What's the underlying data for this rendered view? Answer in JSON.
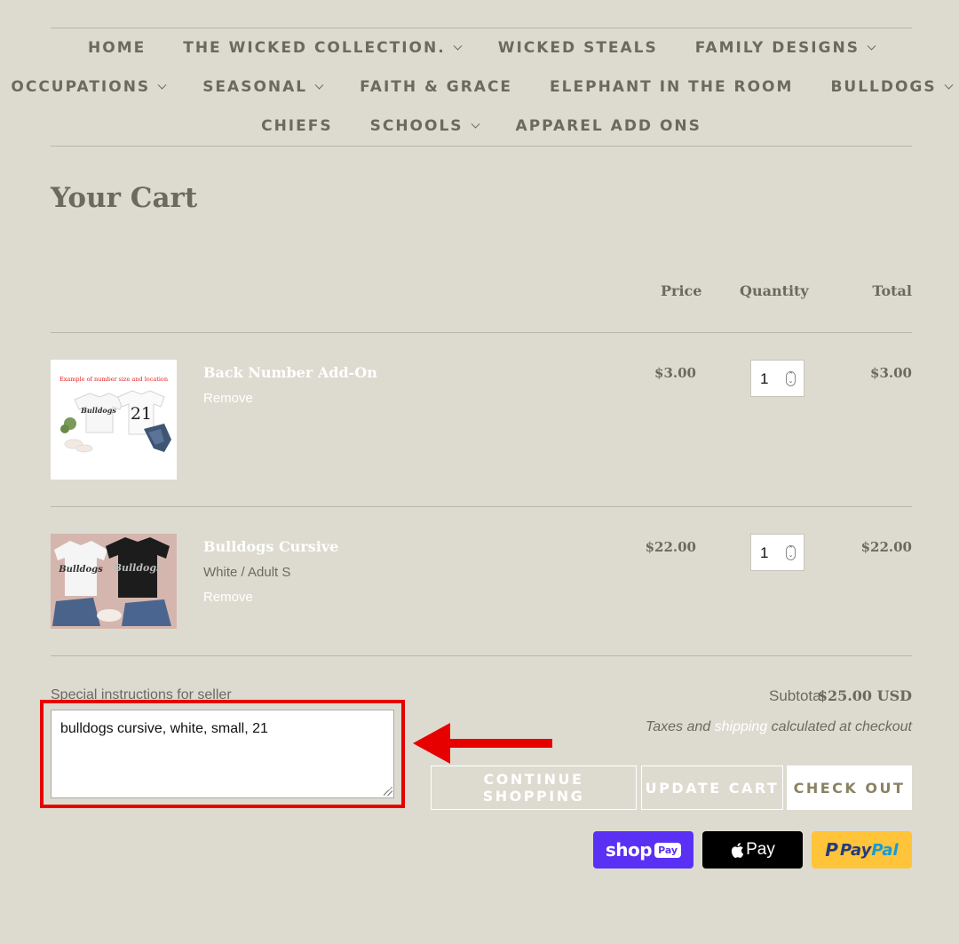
{
  "nav": {
    "row1": [
      {
        "label": "HOME",
        "dropdown": false
      },
      {
        "label": "THE WICKED COLLECTION.",
        "dropdown": true
      },
      {
        "label": "WICKED STEALS",
        "dropdown": false
      },
      {
        "label": "FAMILY DESIGNS",
        "dropdown": true
      }
    ],
    "row2": [
      {
        "label": "OCCUPATIONS",
        "dropdown": true
      },
      {
        "label": "SEASONAL",
        "dropdown": true
      },
      {
        "label": "FAITH & GRACE",
        "dropdown": false
      },
      {
        "label": "ELEPHANT IN THE ROOM",
        "dropdown": false
      },
      {
        "label": "BULLDOGS",
        "dropdown": true
      }
    ],
    "row3": [
      {
        "label": "CHIEFS",
        "dropdown": false
      },
      {
        "label": "SCHOOLS",
        "dropdown": true
      },
      {
        "label": "APPAREL ADD ONS",
        "dropdown": false
      }
    ]
  },
  "page_title": "Your Cart",
  "table_headers": {
    "price": "Price",
    "quantity": "Quantity",
    "total": "Total"
  },
  "items": [
    {
      "name": "Back Number Add-On",
      "variant": "",
      "remove": "Remove",
      "price": "$3.00",
      "quantity": "1",
      "total": "$3.00",
      "thumb_caption": "Example of number size and location",
      "thumb_number": "21",
      "thumb_shirt_text": "Bulldogs"
    },
    {
      "name": "Bulldogs Cursive",
      "variant": "White / Adult S",
      "remove": "Remove",
      "price": "$22.00",
      "quantity": "1",
      "total": "$22.00",
      "thumb_shirt_text": "Bulldogs"
    }
  ],
  "notes": {
    "label": "Special instructions for seller",
    "value": "bulldogs cursive, white, small, 21"
  },
  "summary": {
    "subtotal_label": "Subtotal",
    "subtotal_value": "$25.00 USD",
    "taxes_prefix": "Taxes and ",
    "shipping_link": "shipping",
    "taxes_suffix": " calculated at checkout"
  },
  "buttons": {
    "continue": "CONTINUE SHOPPING",
    "update": "UPDATE CART",
    "checkout": "CHECK OUT"
  },
  "payments": {
    "shop_pay": {
      "text": "shop",
      "badge": "Pay",
      "color": "#5a31f4"
    },
    "apple_pay": {
      "text": "Pay",
      "color": "#000000"
    },
    "paypal": {
      "text_a": "Pay",
      "text_b": "Pal",
      "color": "#ffc439"
    }
  },
  "colors": {
    "background": "#dddbd0",
    "text": "#6b6a5e",
    "annotation_red": "#e60000"
  }
}
